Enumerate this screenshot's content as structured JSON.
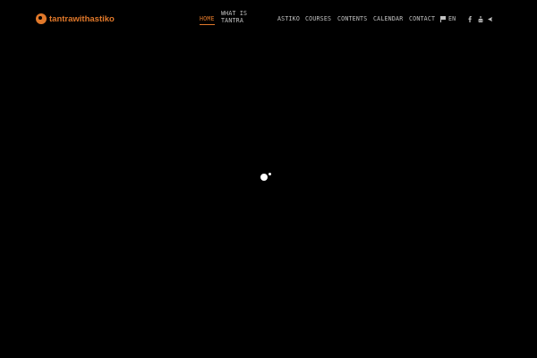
{
  "header": {
    "logo_text": "tantrawithastiko",
    "brand_color": "#e0782a",
    "nav": [
      {
        "label": "HOME",
        "active": true
      },
      {
        "label": "WHAT IS TANTRA",
        "active": false
      },
      {
        "label": "ASTIKO",
        "active": false
      },
      {
        "label": "COURSES",
        "active": false
      },
      {
        "label": "CONTENTS",
        "active": false
      },
      {
        "label": "CALENDAR",
        "active": false
      },
      {
        "label": "CONTACT",
        "active": false
      }
    ],
    "language": "EN",
    "social_icons": [
      "facebook-icon",
      "youtube-icon",
      "telegram-icon"
    ]
  },
  "main": {
    "loader": "loading-spinner"
  }
}
